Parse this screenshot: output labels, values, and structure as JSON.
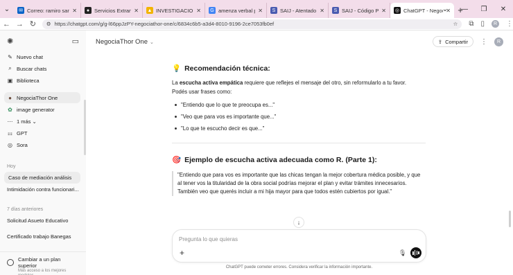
{
  "browser": {
    "tabs": [
      {
        "label": "Correo: ramiro sanch",
        "icon": "outlook-icon",
        "color": "#0a64c8",
        "glyph": "✉"
      },
      {
        "label": "Servicios Extranet",
        "icon": "extranet-icon",
        "color": "#222222",
        "glyph": "●"
      },
      {
        "label": "INVESTIGACION IA",
        "icon": "drive-icon",
        "color": "#f2b400",
        "glyph": "▲"
      },
      {
        "label": "amenza verbal por c",
        "icon": "google-icon",
        "color": "#4285f4",
        "glyph": "G"
      },
      {
        "label": "SAIJ - Atentado cont",
        "icon": "saij-icon",
        "color": "#4a5bb0",
        "glyph": "S"
      },
      {
        "label": "SAIJ - Código Penal",
        "icon": "saij-icon",
        "color": "#4a5bb0",
        "glyph": "S"
      },
      {
        "label": "ChatGPT - Negocia T",
        "icon": "chatgpt-icon",
        "color": "#111111",
        "glyph": "◎"
      }
    ],
    "new_tab": "+",
    "url": "https://chatgpt.com/g/g-l66ppJzPY-negociathor-one/c/6834c6b5-a3d4-8010-9196-2ce7053fb0ef",
    "profile_initial": "R"
  },
  "sidebar": {
    "menu": [
      {
        "label": "Nuevo chat",
        "icon": "edit-icon",
        "glyph": "✎"
      },
      {
        "label": "Buscar chats",
        "icon": "search-icon",
        "glyph": "⌕"
      },
      {
        "label": "Biblioteca",
        "icon": "library-icon",
        "glyph": "▣"
      }
    ],
    "gpts": [
      {
        "label": "NegociaThor One",
        "icon": "negociathor-icon",
        "glyph": "●"
      },
      {
        "label": "image generator",
        "icon": "image-generator-icon",
        "glyph": "✿"
      },
      {
        "label": "1 más",
        "icon": "more-icon",
        "glyph": "⋯"
      },
      {
        "label": "GPT",
        "icon": "gpt-icon",
        "glyph": "⚏"
      },
      {
        "label": "Sora",
        "icon": "sora-icon",
        "glyph": "◎"
      }
    ],
    "today_label": "Hoy",
    "today_chats": [
      "Caso de mediación análisis",
      "Intimidación contra funcionari..."
    ],
    "week_label": "7 días anteriores",
    "week_chats": [
      "Solicitud Asueto Educativo",
      "Certificado trabajo Banegas"
    ],
    "upgrade_title": "Cambiar a un plan superior",
    "upgrade_subtitle": "Más acceso a los mejores modelos"
  },
  "header": {
    "model_name": "NegociaThor One",
    "share_label": "Compartir",
    "avatar_initial": "R"
  },
  "content": {
    "section1": {
      "emoji": "💡",
      "title": "Recomendación técnica:",
      "para_bold": "escucha activa empática",
      "para_pre": "La ",
      "para_post": " requiere que reflejes el mensaje del otro, sin reformularlo a tu favor.",
      "para2": "Podés usar frases como:",
      "bullets": [
        "\"Entiendo que lo que te preocupa es...\"",
        "\"Veo que para vos es importante que...\"",
        "\"Lo que te escucho decir es que...\""
      ]
    },
    "section2": {
      "emoji": "🎯",
      "title": "Ejemplo de escucha activa adecuada como R. (Parte 1):",
      "quote": "\"Entiendo que para vos es importante que las chicas tengan la mejor cobertura médica posible, y que al tener vos la titularidad de la obra social podrías mejorar el plan y evitar trámites innecesarios. También veo que querés incluir a mi hija mayor para que todos estén cubiertos por igual.\""
    }
  },
  "composer": {
    "placeholder": "Pregunta lo que quieras",
    "disclaimer": "ChatGPT puede cometer errores. Considera verificar la información importante."
  }
}
